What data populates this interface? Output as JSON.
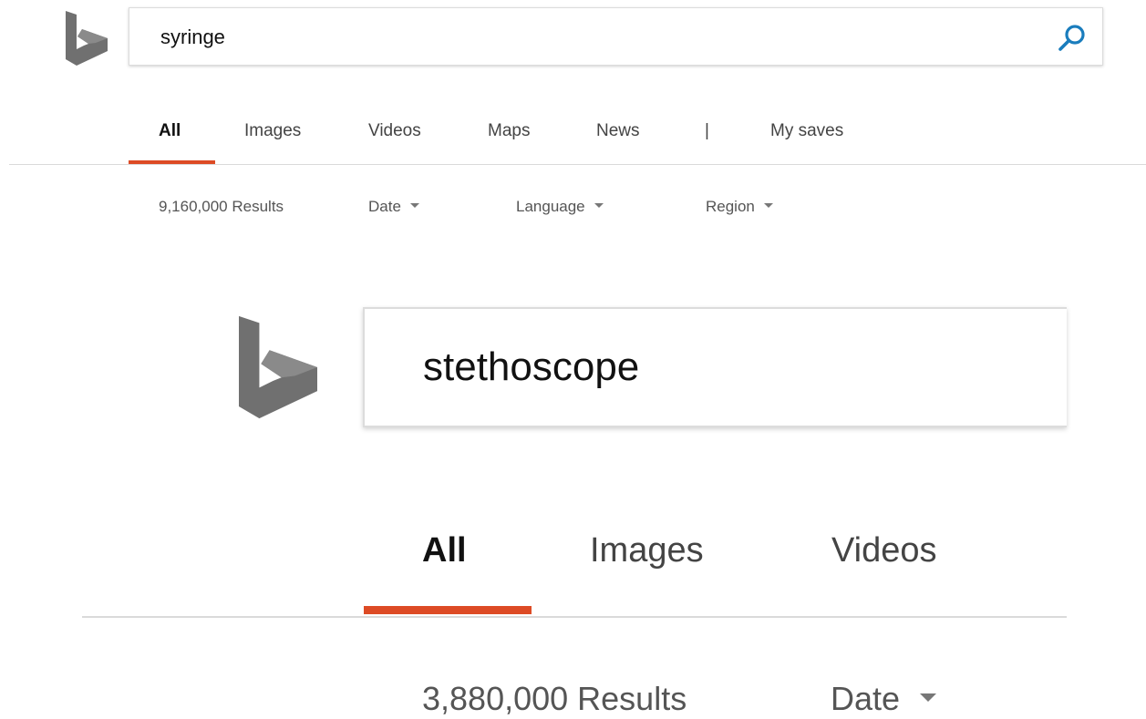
{
  "top": {
    "search": {
      "query": "syringe"
    },
    "tabs": [
      {
        "label": "All",
        "active": true
      },
      {
        "label": "Images"
      },
      {
        "label": "Videos"
      },
      {
        "label": "Maps"
      },
      {
        "label": "News"
      },
      {
        "label": "|"
      },
      {
        "label": "My saves"
      }
    ],
    "results_count": "9,160,000 Results",
    "filters": [
      {
        "label": "Date"
      },
      {
        "label": "Language"
      },
      {
        "label": "Region"
      }
    ]
  },
  "zoomed": {
    "search": {
      "query": "stethoscope"
    },
    "tabs": [
      {
        "label": "All",
        "active": true
      },
      {
        "label": "Images"
      },
      {
        "label": "Videos"
      }
    ],
    "results_count": "3,880,000 Results",
    "filters": [
      {
        "label": "Date"
      }
    ]
  },
  "icons": {
    "logo": "bing-logo-icon",
    "search": "search-icon",
    "dropdown": "caret-down-icon"
  },
  "colors": {
    "accent": "#dd4b25",
    "search_icon": "#1a7dbd",
    "logo_gray": "#707070"
  }
}
